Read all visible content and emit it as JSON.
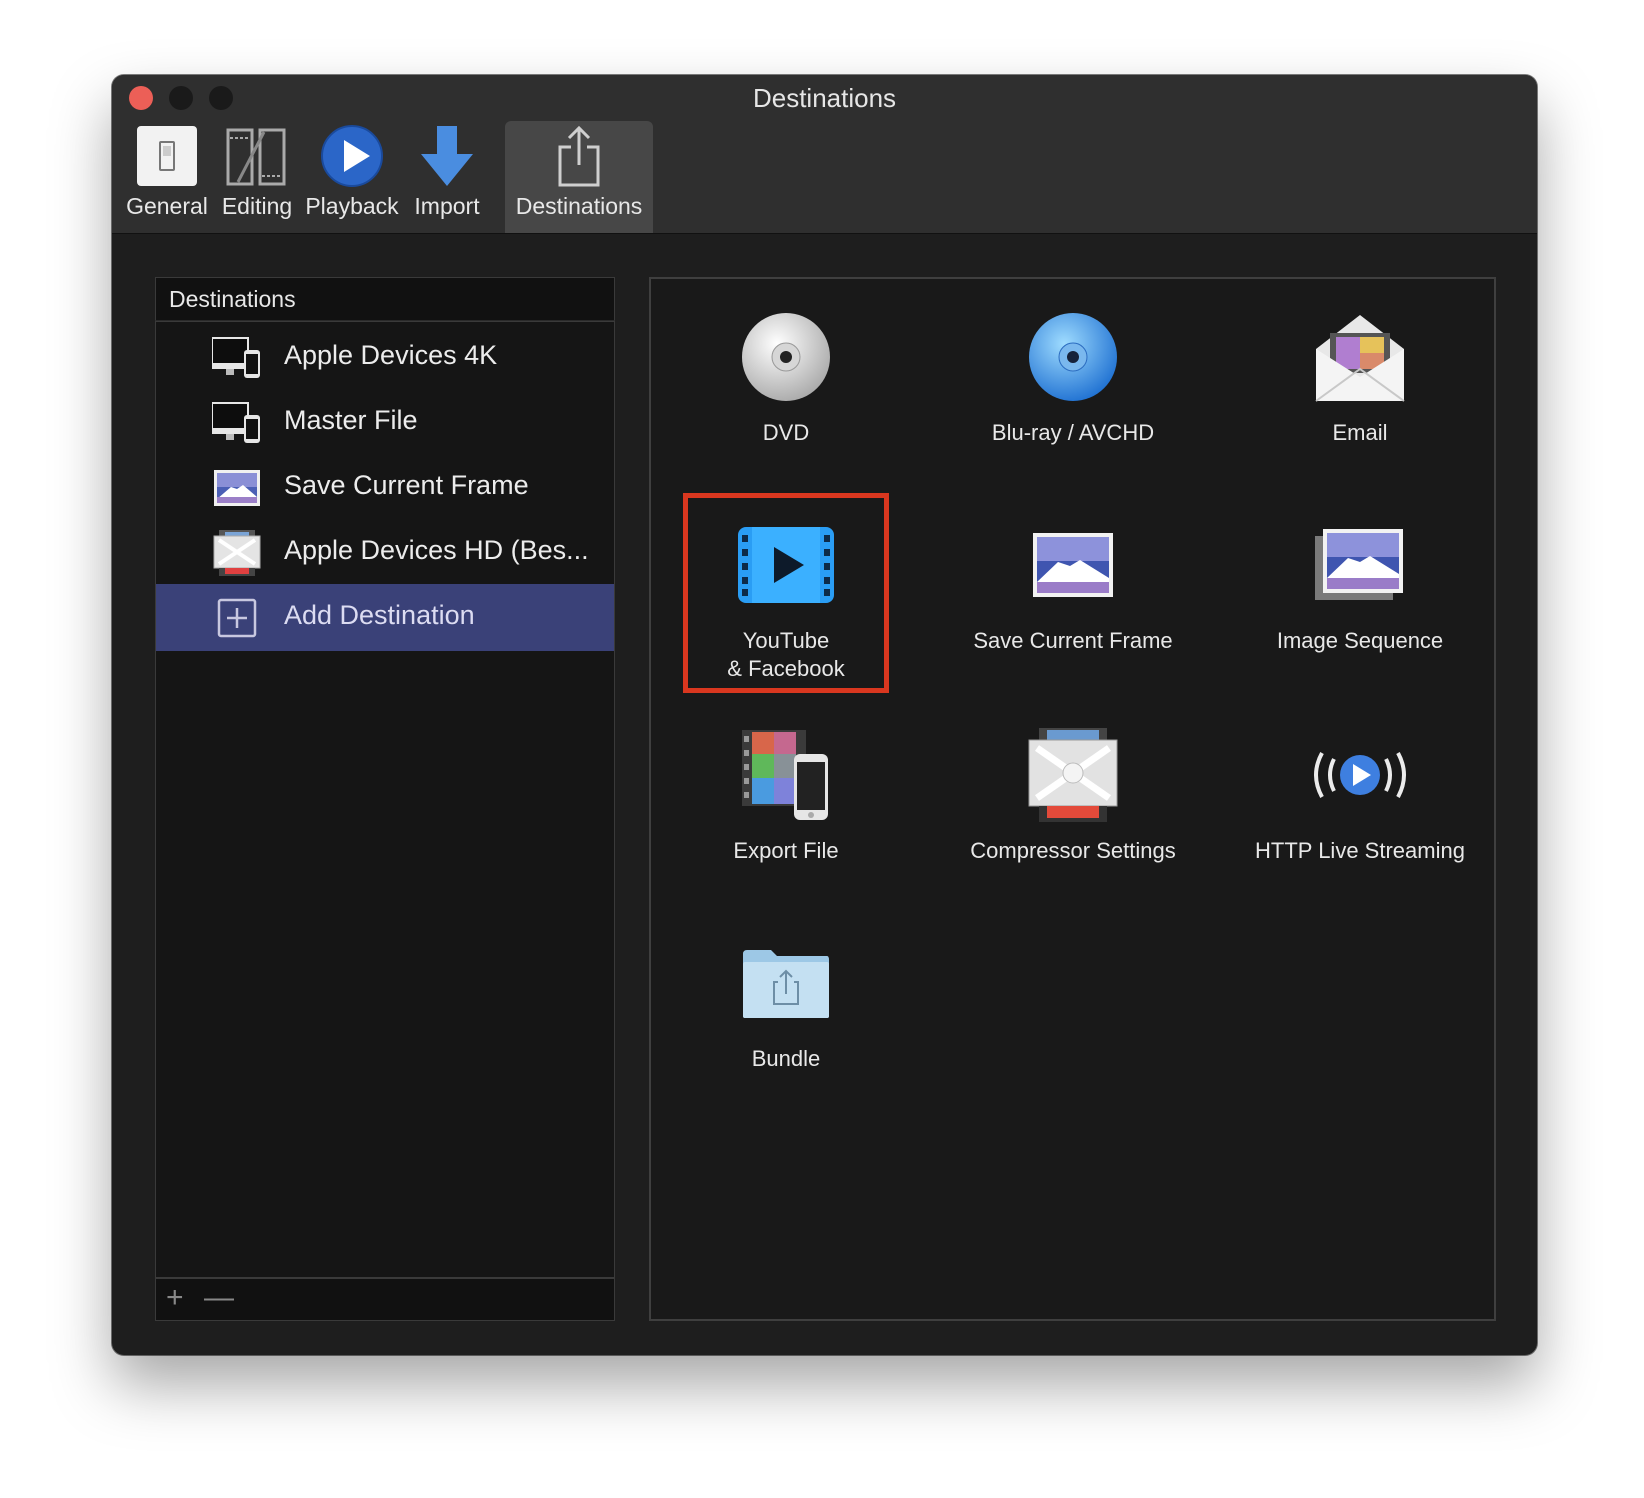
{
  "window": {
    "title": "Destinations"
  },
  "toolbar": {
    "tabs": [
      {
        "label": "General",
        "icon": "general-switch-icon"
      },
      {
        "label": "Editing",
        "icon": "editing-film-icon"
      },
      {
        "label": "Playback",
        "icon": "playback-play-icon"
      },
      {
        "label": "Import",
        "icon": "import-arrow-icon"
      },
      {
        "label": "Destinations",
        "icon": "share-icon",
        "active": true
      }
    ]
  },
  "sidebar": {
    "header": "Destinations",
    "items": [
      {
        "label": "Apple Devices 4K",
        "icon": "apple-devices-icon"
      },
      {
        "label": "Master File",
        "icon": "apple-devices-icon"
      },
      {
        "label": "Save Current Frame",
        "icon": "mountain-image-icon"
      },
      {
        "label": "Apple Devices HD (Bes...",
        "icon": "compressor-icon"
      },
      {
        "label": "Add Destination",
        "icon": "plus-box-icon",
        "selected": true
      }
    ],
    "footer": {
      "add_symbol": "+",
      "remove_symbol": "—"
    }
  },
  "grid": {
    "items": [
      {
        "label": "DVD",
        "icon": "dvd-disc-icon"
      },
      {
        "label": "Blu-ray / AVCHD",
        "icon": "bluray-disc-icon"
      },
      {
        "label": "Email",
        "icon": "email-envelope-icon"
      },
      {
        "label": "YouTube",
        "label2": "& Facebook",
        "icon": "video-play-icon",
        "highlighted": true
      },
      {
        "label": "Save Current Frame",
        "icon": "mountain-image-icon"
      },
      {
        "label": "Image Sequence",
        "icon": "image-stack-icon"
      },
      {
        "label": "Export File",
        "icon": "export-file-icon"
      },
      {
        "label": "Compressor Settings",
        "icon": "compressor-icon"
      },
      {
        "label": "HTTP Live Streaming",
        "icon": "broadcast-icon"
      },
      {
        "label": "Bundle",
        "icon": "bundle-folder-icon"
      }
    ]
  },
  "colors": {
    "highlight": "#d9371f",
    "selection": "#3a4178",
    "close": "#ec5f57"
  }
}
